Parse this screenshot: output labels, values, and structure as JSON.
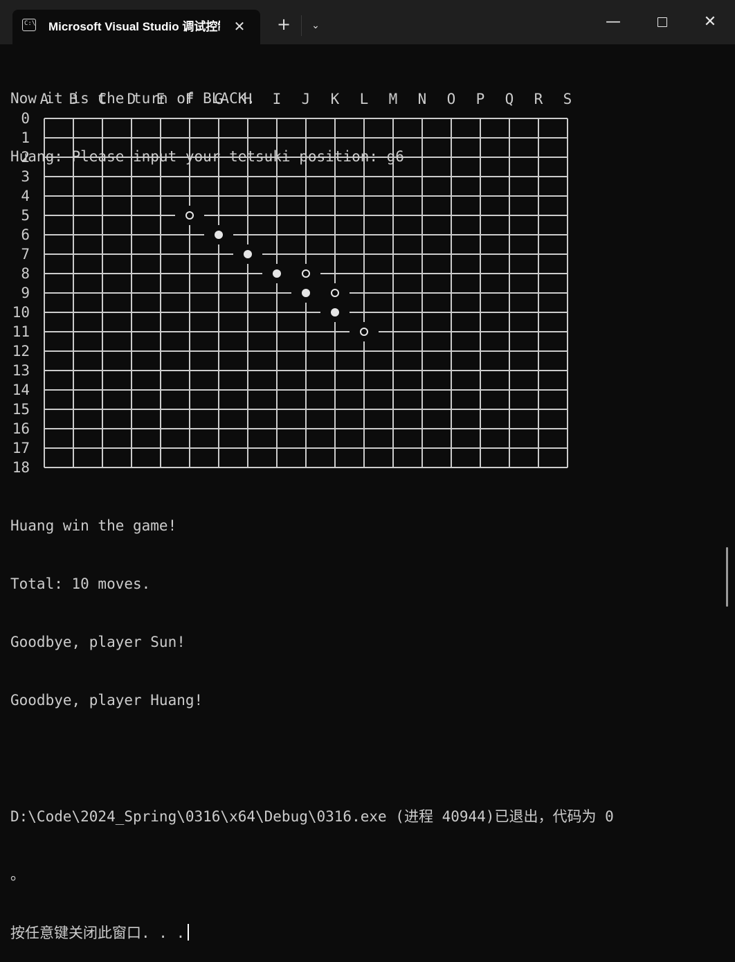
{
  "window": {
    "tab_title": "Microsoft Visual Studio 调试控制台",
    "tab_icon": "terminal-icon",
    "new_tab_label": "+",
    "close_tab_label": "✕",
    "dropdown_label": "⌄",
    "minimize_label": "—",
    "close_label": "✕"
  },
  "output": {
    "header_lines": [
      "Now it is the turn of BLACK.",
      "Huang: Please input your tetsuki position: g6"
    ],
    "footer_lines": [
      "Huang win the game!",
      "Total: 10 moves.",
      "Goodbye, player Sun!",
      "Goodbye, player Huang!",
      "",
      "D:\\Code\\2024_Spring\\0316\\x64\\Debug\\0316.exe (进程 40944)已退出，代码为 0",
      "。",
      "按任意键关闭此窗口. . ."
    ]
  },
  "board": {
    "columns": [
      "A",
      "B",
      "C",
      "D",
      "E",
      "F",
      "G",
      "H",
      "I",
      "J",
      "K",
      "L",
      "M",
      "N",
      "O",
      "P",
      "Q",
      "R",
      "S"
    ],
    "rows": [
      "0",
      "1",
      "2",
      "3",
      "4",
      "5",
      "6",
      "7",
      "8",
      "9",
      "10",
      "11",
      "12",
      "13",
      "14",
      "15",
      "16",
      "17",
      "18"
    ],
    "stones": [
      {
        "col": 5,
        "row": 5,
        "color": "white"
      },
      {
        "col": 6,
        "row": 6,
        "color": "black"
      },
      {
        "col": 7,
        "row": 7,
        "color": "black"
      },
      {
        "col": 8,
        "row": 8,
        "color": "black"
      },
      {
        "col": 9,
        "row": 8,
        "color": "white"
      },
      {
        "col": 9,
        "row": 9,
        "color": "black"
      },
      {
        "col": 10,
        "row": 9,
        "color": "white"
      },
      {
        "col": 10,
        "row": 10,
        "color": "black"
      },
      {
        "col": 11,
        "row": 11,
        "color": "white"
      }
    ]
  },
  "colors": {
    "background": "#0c0c0c",
    "titlebar": "#1f1f1f",
    "text": "#cccccc",
    "grid": "#cccccc"
  }
}
